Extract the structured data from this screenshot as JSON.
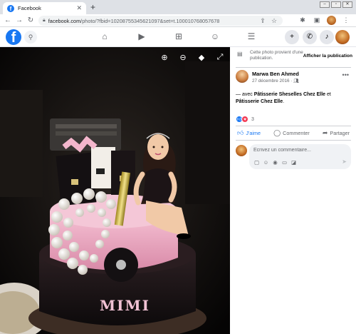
{
  "browser": {
    "tab_title": "Facebook",
    "tab_close": "✕",
    "new_tab": "+",
    "url_host": "facebook.com",
    "url_rest": "/photo/?fbid=1020875534562109​7&set=t.100010768057678",
    "win_min": "▭",
    "win_max": "▭",
    "win_close": "✕"
  },
  "photo": {
    "cake_name": "MIMI"
  },
  "panel": {
    "notice_text": "Cette photo provient d'une publication.",
    "notice_link": "Afficher la publication",
    "poster_name": "Marwa Ben Ahmed",
    "post_date": "27 décembre 2016 · ",
    "caption_prefix": "— avec ",
    "tag_1": "Pâtisserie Sheselles Chez Elle",
    "caption_and": " et ",
    "tag_2": "Pâtisserie Chez Elle",
    "caption_suffix": ".",
    "reaction_count": "3",
    "like_label": "J'aime",
    "comment_label": "Commenter",
    "share_label": "Partager",
    "comment_placeholder": "Écrivez un commentaire..."
  },
  "colors": {
    "facebook_blue": "#1877f2",
    "love_red": "#f33e58",
    "viewer_bg": "#000000"
  },
  "icons": [
    "back-arrow-icon",
    "forward-arrow-icon",
    "reload-icon",
    "lock-icon",
    "share-icon",
    "star-icon",
    "extensions-icon",
    "sidepanel-icon",
    "search-icon",
    "home-icon",
    "video-icon",
    "marketplace-icon",
    "groups-icon",
    "menu-icon",
    "plus-icon",
    "messenger-icon",
    "bell-icon",
    "zoom-in-icon",
    "zoom-out-icon",
    "tag-icon",
    "fullscreen-icon",
    "globe-icon",
    "friends-icon",
    "like-icon",
    "comment-icon",
    "share-arrow-icon",
    "emoji-icon",
    "camera-icon",
    "gif-icon",
    "sticker-icon",
    "send-icon"
  ]
}
